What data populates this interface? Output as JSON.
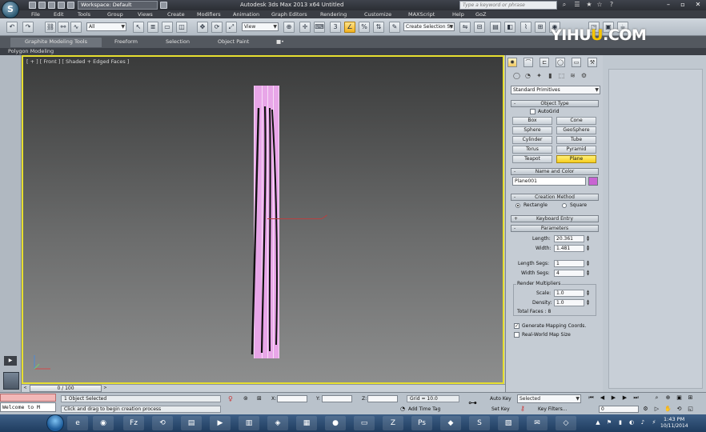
{
  "window": {
    "workspace_label": "Workspace: Default",
    "title": "Autodesk 3ds Max  2013 x64      Untitled",
    "search_placeholder": "Type a keyword or phrase"
  },
  "menu": [
    "File",
    "Edit",
    "Tools",
    "Group",
    "Views",
    "Create",
    "Modifiers",
    "Animation",
    "Graph Editors",
    "Rendering",
    "Customize",
    "MAXScript",
    "Help",
    "GoZ"
  ],
  "toolbar": {
    "selection_filter": "All",
    "ref_coord": "View",
    "named_selection": "Create Selection Se"
  },
  "ribbon": {
    "tabs": [
      "Graphite Modeling Tools",
      "Freeform",
      "Selection",
      "Object Paint"
    ],
    "subtitle": "Polygon Modeling"
  },
  "viewport": {
    "label": "[ + ] [ Front ] [ Shaded + Edged Faces ]",
    "object_color": "#e8a6e8",
    "active_border_color": "#e7df30"
  },
  "command_panel": {
    "category": "Standard Primitives",
    "object_type": {
      "title": "Object Type",
      "autogrid_label": "AutoGrid",
      "buttons": [
        "Box",
        "Cone",
        "Sphere",
        "GeoSphere",
        "Cylinder",
        "Tube",
        "Torus",
        "Pyramid",
        "Teapot",
        "Plane"
      ],
      "active": "Plane"
    },
    "name_and_color": {
      "title": "Name and Color",
      "name": "Plane001",
      "color": "#c864d2"
    },
    "creation_method": {
      "title": "Creation Method",
      "options": [
        "Rectangle",
        "Square"
      ],
      "selected": "Rectangle"
    },
    "keyboard_entry": {
      "title": "Keyboard Entry"
    },
    "parameters": {
      "title": "Parameters",
      "length_label": "Length:",
      "length": "20.361",
      "width_label": "Width:",
      "width": "1.481",
      "length_segs_label": "Length Segs:",
      "length_segs": "1",
      "width_segs_label": "Width Segs:",
      "width_segs": "4",
      "render_multipliers_title": "Render Multipliers",
      "scale_label": "Scale:",
      "scale": "1.0",
      "density_label": "Density:",
      "density": "1.0",
      "total_faces": "Total Faces : 8",
      "gen_mapping_label": "Generate Mapping Coords.",
      "gen_mapping_checked": true,
      "real_world_label": "Real-World Map Size",
      "real_world_checked": false
    }
  },
  "timeline": {
    "frame": "0 / 100"
  },
  "status": {
    "selected": "1 Object Selected",
    "prompt": "Click and drag to begin creation process",
    "x_label": "X:",
    "y_label": "Y:",
    "z_label": "Z:",
    "grid": "Grid = 10.0",
    "add_time_tag": "Add Time Tag",
    "auto_key": "Auto Key",
    "set_key": "Set Key",
    "selected_dropdown": "Selected",
    "key_filters": "Key Filters...",
    "frame_field": "0"
  },
  "maxscript": {
    "text": "Welcome to M"
  },
  "taskbar": {
    "time": "1:43 PM",
    "date": "10/11/2014"
  },
  "watermark": {
    "pre": "YIHU",
    "u": "U",
    "post": ".COM"
  }
}
